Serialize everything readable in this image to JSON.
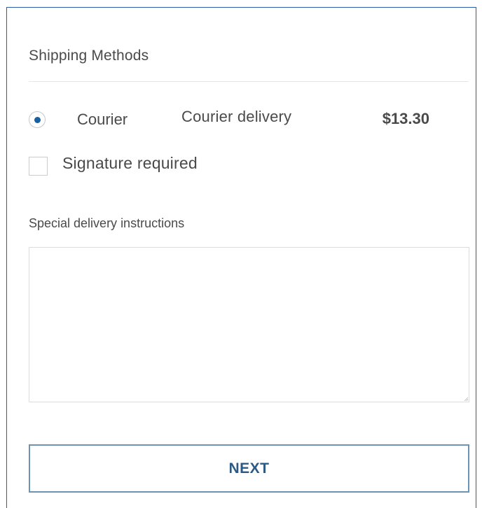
{
  "shipping": {
    "title": "Shipping Methods",
    "method": {
      "name": "Courier",
      "description": "Courier delivery",
      "price": "$13.30",
      "selected": true
    },
    "signature": {
      "label": "Signature required",
      "checked": false
    },
    "instructions": {
      "label": "Special delivery instructions",
      "value": ""
    },
    "next_label": "NEXT"
  },
  "colors": {
    "panel_border": "#2b5cab",
    "accent": "#1a5f9e",
    "button_border": "#6d93b4",
    "button_text": "#2c5a86"
  }
}
